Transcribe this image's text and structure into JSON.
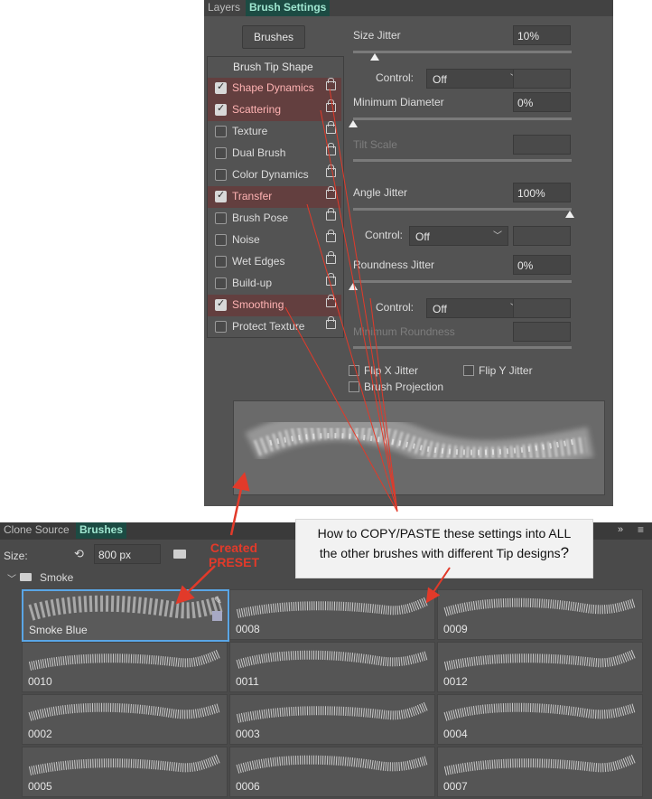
{
  "brush_settings": {
    "tabs": [
      "Layers",
      "Brush Settings"
    ],
    "brushes_button": "Brushes",
    "tip_shape_label": "Brush Tip Shape",
    "options": [
      {
        "label": "Shape Dynamics",
        "checked": true
      },
      {
        "label": "Scattering",
        "checked": true
      },
      {
        "label": "Texture",
        "checked": false
      },
      {
        "label": "Dual Brush",
        "checked": false
      },
      {
        "label": "Color Dynamics",
        "checked": false
      },
      {
        "label": "Transfer",
        "checked": true
      },
      {
        "label": "Brush Pose",
        "checked": false
      },
      {
        "label": "Noise",
        "checked": false
      },
      {
        "label": "Wet Edges",
        "checked": false
      },
      {
        "label": "Build-up",
        "checked": false
      },
      {
        "label": "Smoothing",
        "checked": true
      },
      {
        "label": "Protect Texture",
        "checked": false
      }
    ],
    "size_jitter": {
      "label": "Size Jitter",
      "value": "10%",
      "level": 0.1
    },
    "control_label": "Control:",
    "control_1": "Off",
    "minimum_diameter": {
      "label": "Minimum Diameter",
      "value": "0%",
      "level": 0.0
    },
    "tilt_scale": {
      "label": "Tilt Scale"
    },
    "angle_jitter": {
      "label": "Angle Jitter",
      "value": "100%",
      "level": 1.0
    },
    "control_2": "Off",
    "roundness_jitter": {
      "label": "Roundness Jitter",
      "value": "0%",
      "level": 0.0
    },
    "control_3": "Off",
    "minimum_roundness": {
      "label": "Minimum Roundness"
    },
    "flip_x": "Flip X Jitter",
    "flip_y": "Flip Y Jitter",
    "brush_projection": "Brush Projection"
  },
  "brushes_panel": {
    "tabs": [
      "Clone Source",
      "Brushes"
    ],
    "size_label": "Size:",
    "size_value": "800 px",
    "group_name": "Smoke",
    "presets": [
      "Smoke Blue",
      "0008",
      "0009",
      "0010",
      "0011",
      "0012",
      "0002",
      "0003",
      "0004",
      "0005",
      "0006",
      "0007"
    ]
  },
  "annotation": {
    "question_line1": "How to COPY/PASTE these settings into ALL",
    "question_line2": "the other brushes with different Tip designs",
    "question_mark": "?",
    "preset_line1": "Created",
    "preset_line2": "PRESET",
    "arrow_color": "#e23a2a"
  }
}
